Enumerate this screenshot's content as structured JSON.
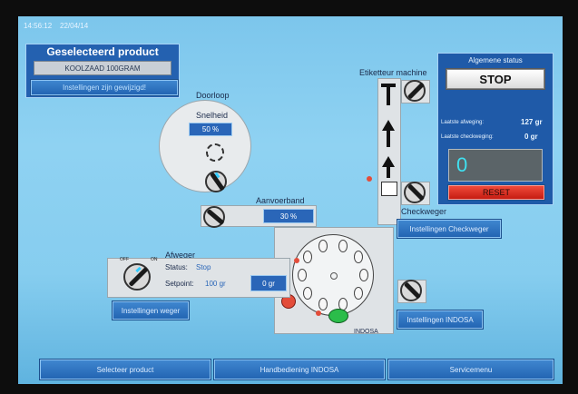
{
  "header": {
    "time": "14:56:12",
    "date": "22/04/14"
  },
  "product_panel": {
    "title": "Geselecteerd product",
    "product_name": "KOOLZAAD 100GRAM",
    "settings_link": "Instellingen zijn gewijzigd!"
  },
  "doorloop": {
    "title": "Doorloop",
    "speed_label": "Snelheid",
    "speed_value": "50 %"
  },
  "aanvoerband": {
    "title": "Aanvoerband",
    "value": "30 %"
  },
  "etiketteur": {
    "title": "Etiketteur machine"
  },
  "status_panel": {
    "title": "Algemene status",
    "status_button": "STOP",
    "last_weigh_label": "Laatste afweging:",
    "last_weigh_value": "127 gr",
    "last_check_label": "Laatste checkweging:",
    "last_check_value": "0 gr",
    "counter_value": "0",
    "reset_button": "RESET"
  },
  "checkweger": {
    "title": "Checkweger",
    "settings_button": "Instellingen Checkweger"
  },
  "afweger": {
    "title": "Afweger",
    "status_label": "Status:",
    "status_value": "Stop",
    "setpoint_label": "Setpoint:",
    "setpoint_value": "100 gr",
    "current_value": "0 gr",
    "settings_button": "Instellingen weger"
  },
  "indosa": {
    "label": "INDOSA",
    "settings_button": "Instellingen INDOSA"
  },
  "switch_labels": {
    "off": "OFF",
    "on": "ON"
  },
  "bottom_nav": {
    "select_product": "Selecteer product",
    "manual_control": "Handbediening INDOSA",
    "service_menu": "Servicemenu"
  },
  "colors": {
    "accent": "#2a66b8",
    "stop_red": "#e34d3a",
    "reset_red": "#d22",
    "counter_text": "#3fe0f0",
    "indicator_green": "#2bbd4a"
  }
}
